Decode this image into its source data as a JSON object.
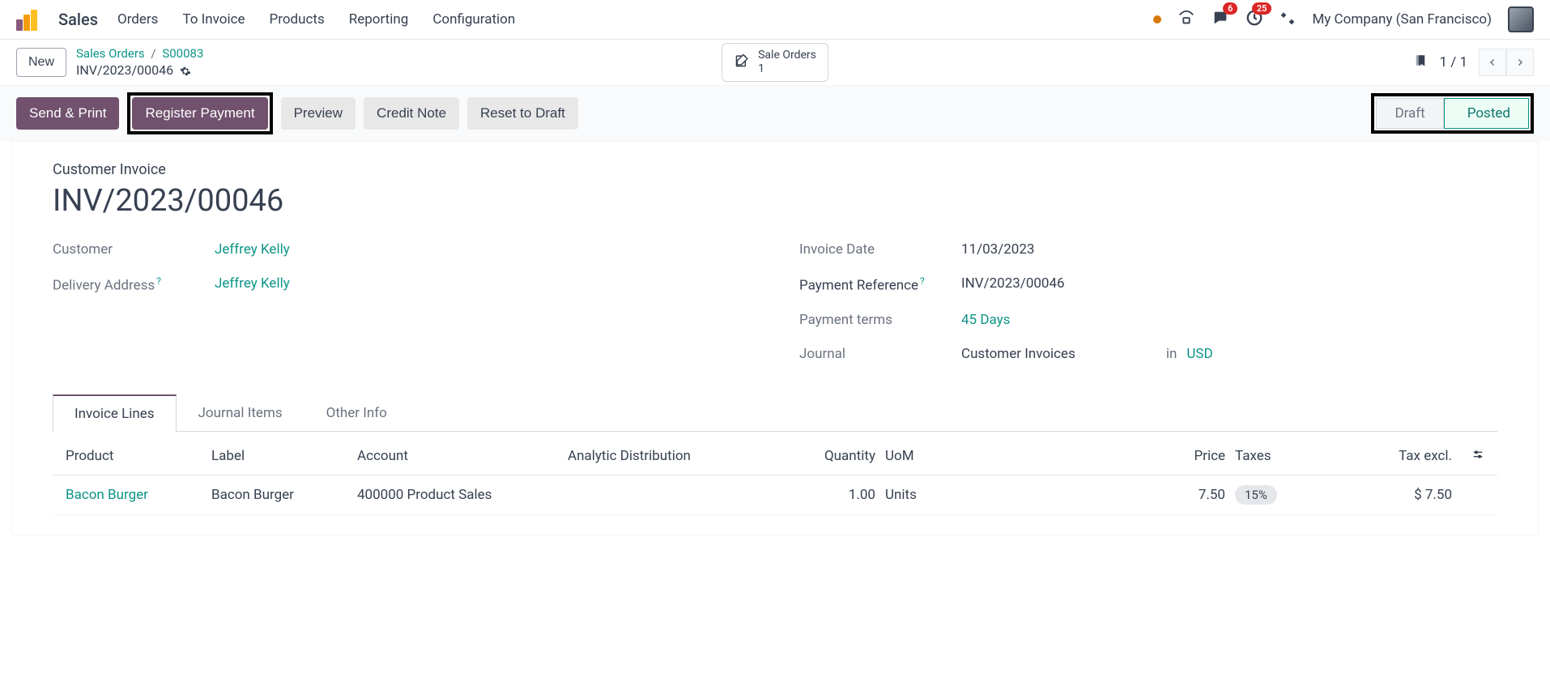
{
  "nav": {
    "app": "Sales",
    "menu": [
      "Orders",
      "To Invoice",
      "Products",
      "Reporting",
      "Configuration"
    ],
    "badge_messages": "6",
    "badge_activities": "25",
    "company": "My Company (San Francisco)"
  },
  "subheader": {
    "new": "New",
    "breadcrumb_root": "Sales Orders",
    "breadcrumb_sep": "/",
    "breadcrumb_order": "S00083",
    "record_name": "INV/2023/00046"
  },
  "smart": {
    "title": "Sale Orders",
    "count": "1"
  },
  "pager": {
    "text": "1 / 1"
  },
  "buttons": {
    "send_print": "Send & Print",
    "register_payment": "Register Payment",
    "preview": "Preview",
    "credit_note": "Credit Note",
    "reset_draft": "Reset to Draft"
  },
  "status": {
    "draft": "Draft",
    "posted": "Posted"
  },
  "doc": {
    "type": "Customer Invoice",
    "title": "INV/2023/00046"
  },
  "fields": {
    "left": {
      "customer_label": "Customer",
      "customer_value": "Jeffrey Kelly",
      "delivery_label": "Delivery Address",
      "delivery_value": "Jeffrey Kelly"
    },
    "right": {
      "invoice_date_label": "Invoice Date",
      "invoice_date_value": "11/03/2023",
      "payment_ref_label": "Payment Reference",
      "payment_ref_value": "INV/2023/00046",
      "payment_terms_label": "Payment terms",
      "payment_terms_value": "45 Days",
      "journal_label": "Journal",
      "journal_value": "Customer Invoices",
      "journal_in": "in",
      "journal_currency": "USD"
    }
  },
  "tabs": [
    "Invoice Lines",
    "Journal Items",
    "Other Info"
  ],
  "table": {
    "headers": {
      "product": "Product",
      "label": "Label",
      "account": "Account",
      "analytic": "Analytic Distribution",
      "qty": "Quantity",
      "uom": "UoM",
      "price": "Price",
      "taxes": "Taxes",
      "taxexcl": "Tax excl."
    },
    "rows": [
      {
        "product": "Bacon Burger",
        "label": "Bacon Burger",
        "account": "400000 Product Sales",
        "analytic": "",
        "qty": "1.00",
        "uom": "Units",
        "price": "7.50",
        "taxes": "15%",
        "taxexcl": "$ 7.50"
      }
    ]
  }
}
